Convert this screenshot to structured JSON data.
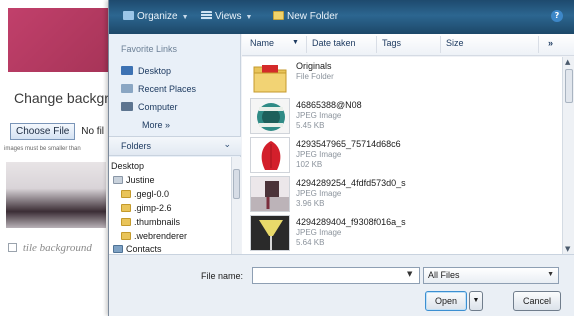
{
  "background_page": {
    "heading": "Change backgro",
    "choose_file_label": "Choose File",
    "no_file_label": "No fil",
    "note": "images must be smaller than",
    "tile_label": "tile background"
  },
  "dialog": {
    "toolbar": {
      "organize": "Organize",
      "views": "Views",
      "new_folder": "New Folder"
    },
    "nav": {
      "favorite_links_heading": "Favorite Links",
      "links": [
        {
          "label": "Desktop",
          "icon": "desktop-icon"
        },
        {
          "label": "Recent Places",
          "icon": "recent-places-icon"
        },
        {
          "label": "Computer",
          "icon": "computer-icon"
        }
      ],
      "more": "More »",
      "folders": "Folders",
      "tree": [
        "Desktop",
        "Justine",
        ".gegl-0.0",
        ".gimp-2.6",
        ".thumbnails",
        ".webrenderer",
        "Contacts"
      ]
    },
    "columns": {
      "name": "Name",
      "date_taken": "Date taken",
      "tags": "Tags",
      "size": "Size",
      "more": "»"
    },
    "files": [
      {
        "name": "Originals",
        "type": "File Folder",
        "size": ""
      },
      {
        "name": "46865388@N08",
        "type": "JPEG Image",
        "size": "5.45 KB"
      },
      {
        "name": "4293547965_75714d68c6",
        "type": "JPEG Image",
        "size": "102 KB"
      },
      {
        "name": "4294289254_4fdfd573d0_s",
        "type": "JPEG Image",
        "size": "3.96 KB"
      },
      {
        "name": "4294289404_f9308f016a_s",
        "type": "JPEG Image",
        "size": "5.64 KB"
      }
    ],
    "footer": {
      "file_name_label": "File name:",
      "file_name_value": "",
      "filter_value": "All Files",
      "open_label": "Open",
      "cancel_label": "Cancel"
    }
  },
  "colors": {
    "toolbar": "#2c6690",
    "nav_pane": "#e9f0f8",
    "swatch": "#c1406b",
    "folder_yellow": "#e9c45a"
  }
}
